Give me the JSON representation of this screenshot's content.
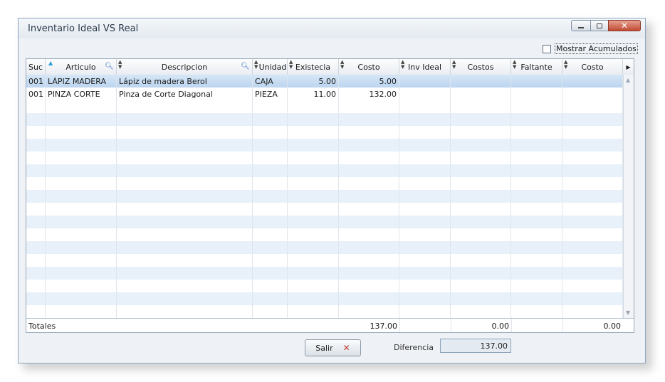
{
  "window": {
    "title": "Inventario Ideal VS Real"
  },
  "options": {
    "show_accumulated_label": "Mostrar Acumulados",
    "show_accumulated_checked": false
  },
  "columns": [
    {
      "label": "Suc",
      "icon": "sort-icon"
    },
    {
      "label": "Articulo",
      "icon": "search-icon"
    },
    {
      "label": "Descripcion",
      "icon": "search-icon"
    },
    {
      "label": "Unidad",
      "icon": "sort-icon"
    },
    {
      "label": "Existecia",
      "icon": "sort-icon"
    },
    {
      "label": "Costo",
      "icon": "sort-icon"
    },
    {
      "label": "Inv Ideal",
      "icon": "sort-icon"
    },
    {
      "label": "Costos",
      "icon": "sort-icon"
    },
    {
      "label": "Faltante",
      "icon": "sort-icon"
    },
    {
      "label": "Costo",
      "icon": "sort-icon"
    }
  ],
  "rows": [
    {
      "suc": "001",
      "articulo": "LÁPIZ MADERA",
      "descripcion": "Lápiz de madera Berol",
      "unidad": "CAJA",
      "existencia": "5.00",
      "costo": "5.00",
      "inv_ideal": "",
      "costos": "",
      "faltante": "",
      "costo2": ""
    },
    {
      "suc": "001",
      "articulo": "PINZA CORTE",
      "descripcion": "Pinza de Corte Diagonal",
      "unidad": "PIEZA",
      "existencia": "11.00",
      "costo": "132.00",
      "inv_ideal": "",
      "costos": "",
      "faltante": "",
      "costo2": ""
    }
  ],
  "totals": {
    "label": "Totales",
    "costo": "137.00",
    "costos": "0.00",
    "costo2": "0.00"
  },
  "footer": {
    "exit_label": "Salir",
    "difference_label": "Diferencia",
    "difference_value": "137.00"
  }
}
